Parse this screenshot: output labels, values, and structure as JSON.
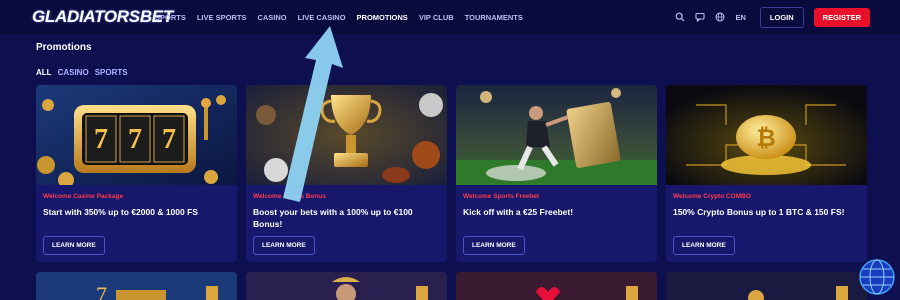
{
  "header": {
    "logo": "GLADIATORSBET",
    "nav": [
      {
        "label": "SPORTS",
        "active": false
      },
      {
        "label": "LIVE SPORTS",
        "active": false
      },
      {
        "label": "CASINO",
        "active": false
      },
      {
        "label": "LIVE CASINO",
        "active": false
      },
      {
        "label": "PROMOTIONS",
        "active": true
      },
      {
        "label": "VIP CLUB",
        "active": false
      },
      {
        "label": "TOURNAMENTS",
        "active": false
      }
    ],
    "icons": [
      "search-icon",
      "chat-icon",
      "globe-icon"
    ],
    "language": "EN",
    "login_label": "LOGIN",
    "register_label": "REGISTER"
  },
  "page": {
    "title": "Promotions",
    "filters": [
      {
        "label": "ALL",
        "active": true
      },
      {
        "label": "CASINO",
        "active": false
      },
      {
        "label": "SPORTS",
        "active": false
      }
    ]
  },
  "cards": [
    {
      "tag": "Welcome Casino Package",
      "title": "Start with 350% up to €2000 & 1000 FS",
      "button": "LEARN MORE",
      "image": "slot-machine-777"
    },
    {
      "tag": "Welcome Sports Bonus",
      "title": "Boost your bets with a 100% up to €100 Bonus!",
      "button": "LEARN MORE",
      "image": "golden-trophy"
    },
    {
      "tag": "Welcome Sports Freebet",
      "title": "Kick off with a €25 Freebet!",
      "button": "LEARN MORE",
      "image": "football-player-ticket"
    },
    {
      "tag": "Welcome Crypto COMBO",
      "title": "150% Crypto Bonus up to 1 BTC & 150 FS!",
      "button": "LEARN MORE",
      "image": "golden-bitcoin"
    }
  ],
  "colors": {
    "background": "#0e0f4f",
    "header": "#0a0b3d",
    "card": "#17186b",
    "accent_red": "#e8102a",
    "tag_red": "#ff3b4a",
    "arrow": "#8fd3f4"
  }
}
